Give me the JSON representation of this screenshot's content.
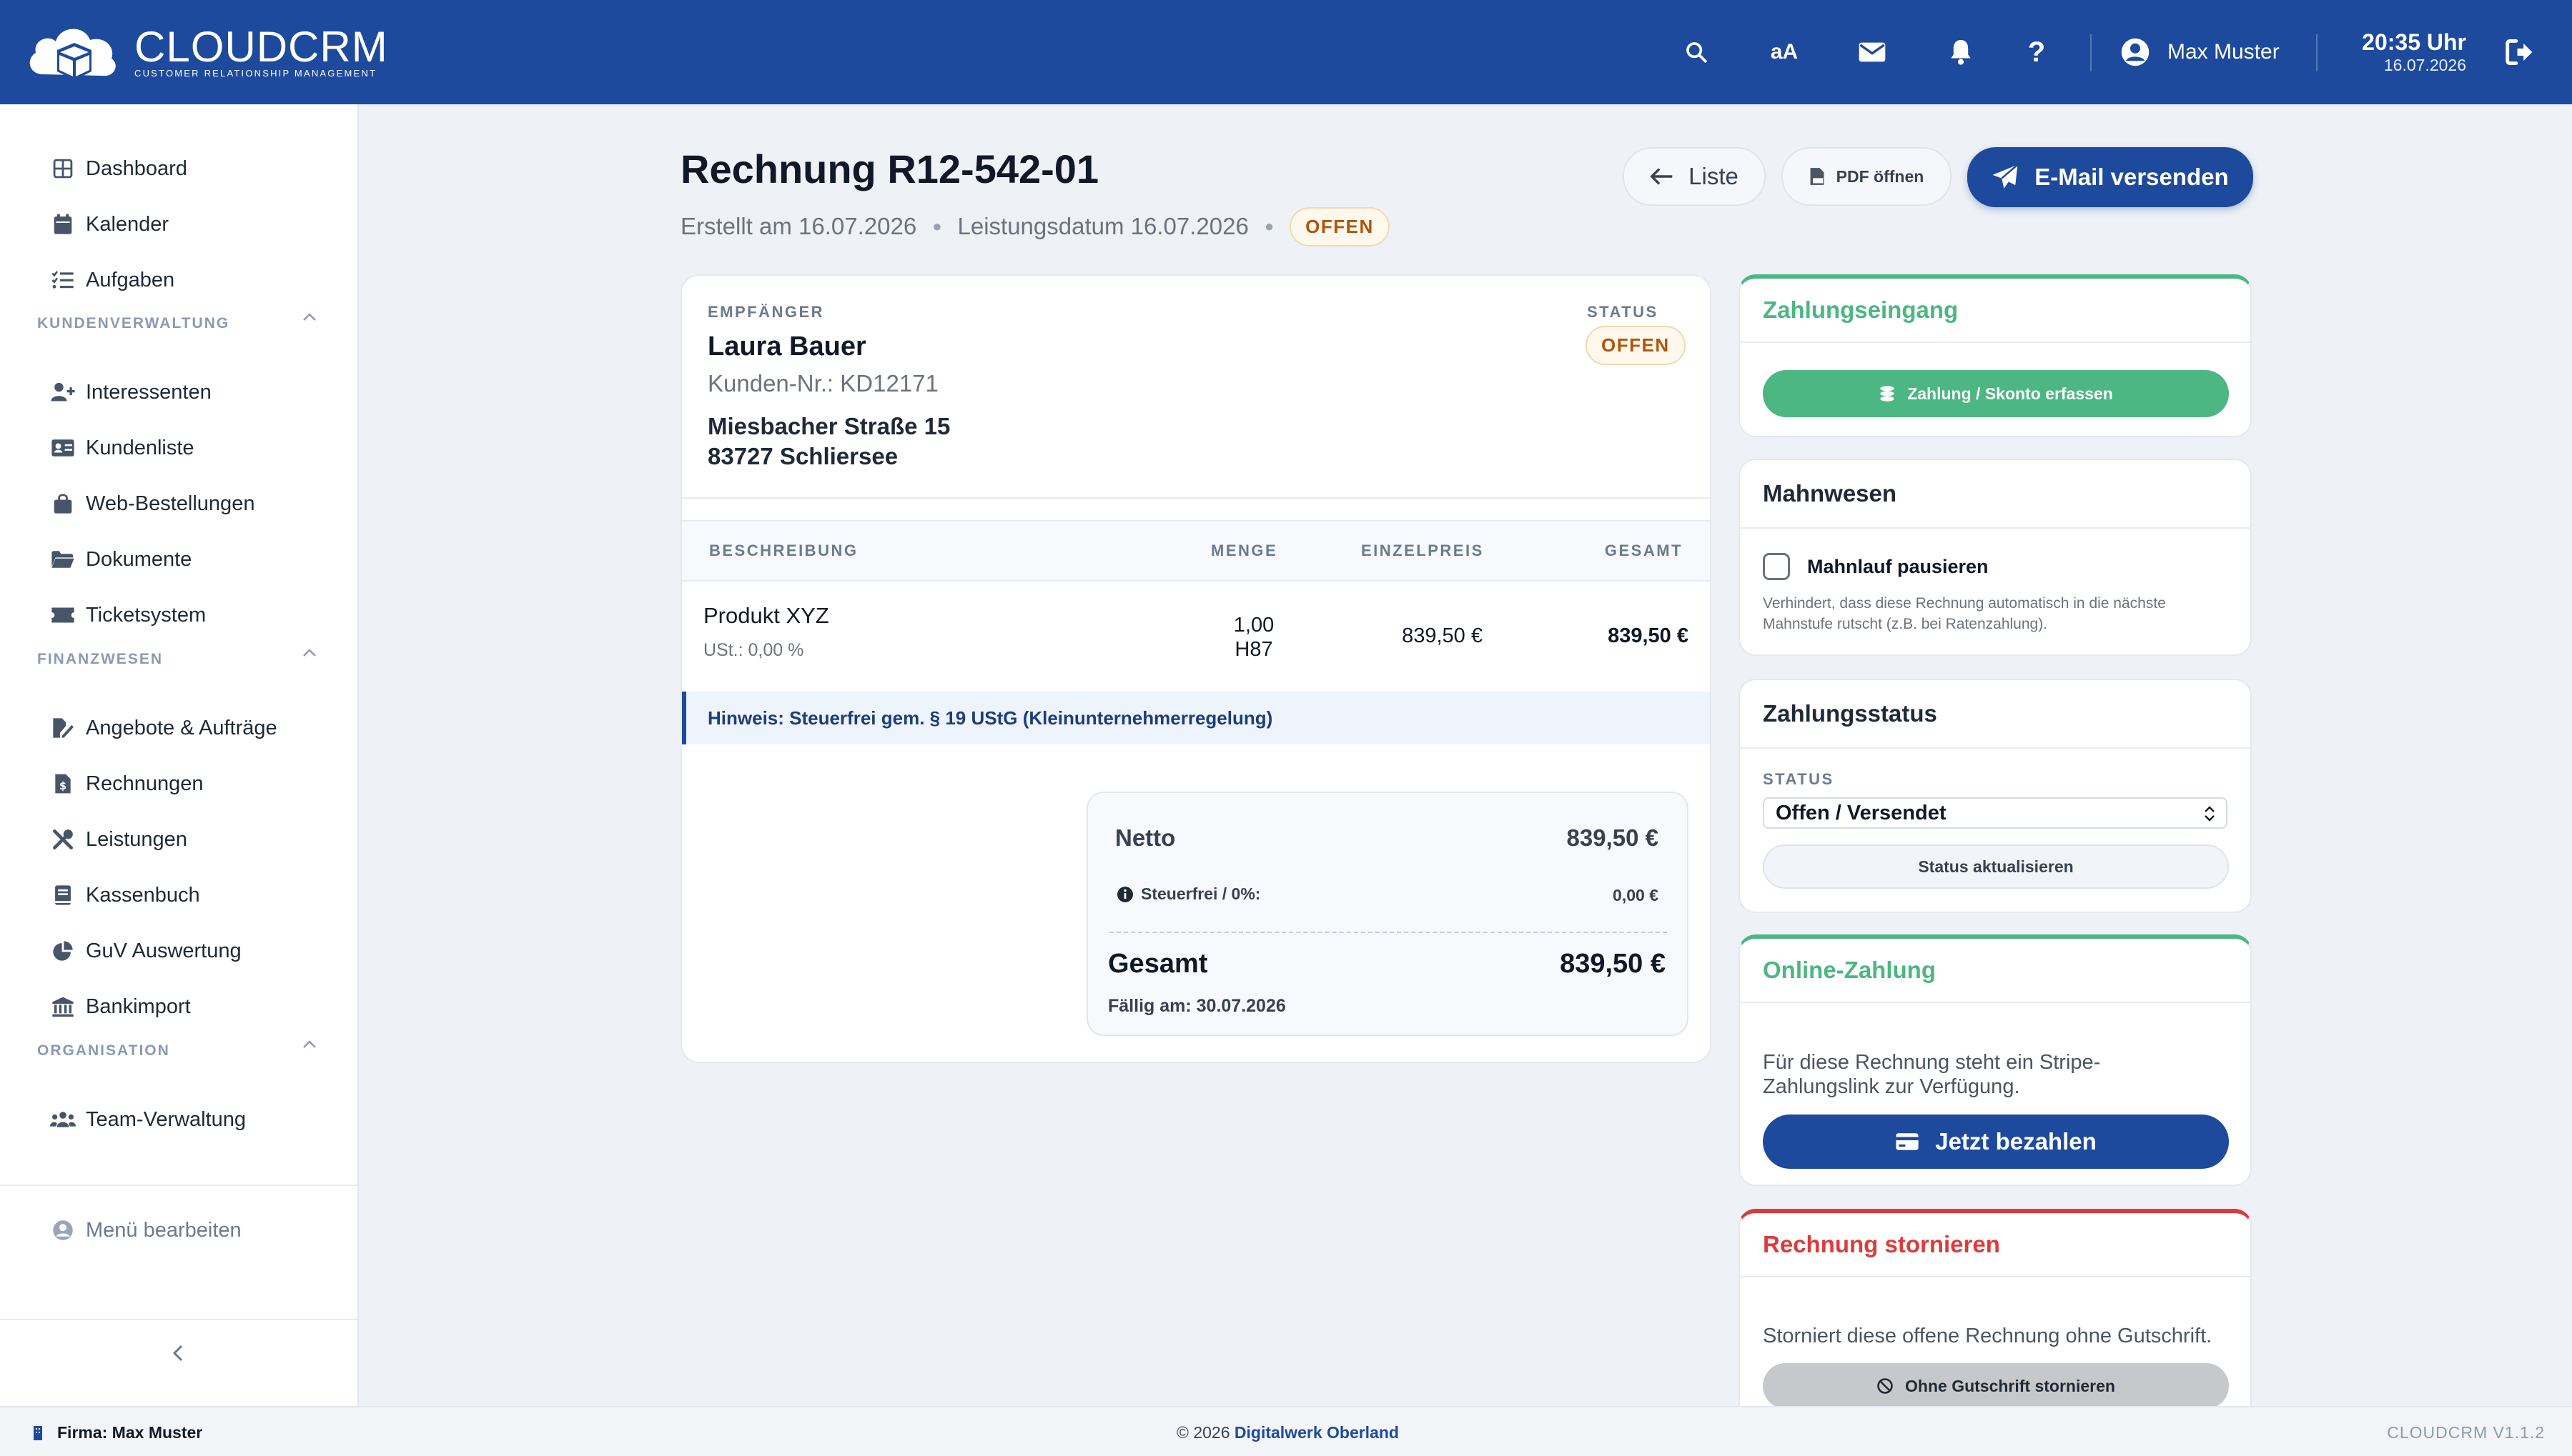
{
  "app": {
    "logo_name": "CLOUDCRM",
    "logo_sub": "CUSTOMER RELATIONSHIP MANAGEMENT",
    "user_name": "Max Muster",
    "time": "20:35 Uhr",
    "date": "16.07.2026",
    "font_size_label": "aA"
  },
  "sidebar": {
    "top_items": [
      {
        "label": "Dashboard",
        "icon": "dashboard-icon"
      },
      {
        "label": "Kalender",
        "icon": "calendar-icon"
      },
      {
        "label": "Aufgaben",
        "icon": "tasks-icon"
      }
    ],
    "sections": [
      {
        "title": "KUNDENVERWALTUNG",
        "items": [
          {
            "label": "Interessenten",
            "icon": "user-plus-icon"
          },
          {
            "label": "Kundenliste",
            "icon": "id-card-icon"
          },
          {
            "label": "Web-Bestellungen",
            "icon": "shopping-bag-icon"
          },
          {
            "label": "Dokumente",
            "icon": "folder-icon"
          },
          {
            "label": "Ticketsystem",
            "icon": "ticket-icon"
          }
        ]
      },
      {
        "title": "FINANZWESEN",
        "items": [
          {
            "label": "Angebote & Aufträge",
            "icon": "file-signature-icon"
          },
          {
            "label": "Rechnungen",
            "icon": "invoice-icon"
          },
          {
            "label": "Leistungen",
            "icon": "tools-icon"
          },
          {
            "label": "Kassenbuch",
            "icon": "book-icon"
          },
          {
            "label": "GuV Auswertung",
            "icon": "pie-chart-icon"
          },
          {
            "label": "Bankimport",
            "icon": "bank-icon"
          }
        ]
      },
      {
        "title": "ORGANISATION",
        "items": [
          {
            "label": "Team-Verwaltung",
            "icon": "users-icon"
          }
        ]
      }
    ],
    "edit_menu": "Menü bearbeiten"
  },
  "invoice": {
    "title": "Rechnung R12-542-01",
    "created": "Erstellt am 16.07.2026",
    "service_date": "Leistungsdatum 16.07.2026",
    "status_badge": "OFFEN",
    "buttons": {
      "list": "Liste",
      "pdf": "PDF öffnen",
      "email": "E-Mail versenden"
    },
    "recipient_label": "EMPFÄNGER",
    "recipient_name": "Laura Bauer",
    "customer_no": "Kunden-Nr.: KD12171",
    "street": "Miesbacher Straße 15",
    "city": "83727 Schliersee",
    "status_label": "STATUS",
    "status_value": "OFFEN",
    "table": {
      "headers": [
        "BESCHREIBUNG",
        "MENGE",
        "EINZELPREIS",
        "GESAMT"
      ],
      "rows": [
        {
          "desc": "Produkt XYZ",
          "tax": "USt.: 0,00 %",
          "qty": "1,00",
          "unit": "H87",
          "price": "839,50 €",
          "total": "839,50 €"
        }
      ]
    },
    "note": "Hinweis: Steuerfrei gem. § 19 UStG (Kleinunternehmerregelung)",
    "totals": {
      "net_label": "Netto",
      "net_value": "839,50 €",
      "tax_label": "Steuerfrei / 0%:",
      "tax_value": "0,00 €",
      "total_label": "Gesamt",
      "total_value": "839,50 €",
      "due": "Fällig am: 30.07.2026"
    }
  },
  "panels": {
    "payment": {
      "title": "Zahlungseingang",
      "button": "Zahlung / Skonto erfassen"
    },
    "dunning": {
      "title": "Mahnwesen",
      "checkbox_label": "Mahnlauf pausieren",
      "checked": false,
      "help": "Verhindert, dass diese Rechnung automatisch in die nächste Mahnstufe rutscht (z.B. bei Ratenzahlung)."
    },
    "status": {
      "title": "Zahlungsstatus",
      "label": "STATUS",
      "selected": "Offen / Versendet",
      "button": "Status aktualisieren"
    },
    "online": {
      "title": "Online-Zahlung",
      "text": "Für diese Rechnung steht ein Stripe-Zahlungslink zur Verfügung.",
      "button": "Jetzt bezahlen"
    },
    "cancel": {
      "title": "Rechnung stornieren",
      "text": "Storniert diese offene Rechnung ohne Gutschrift.",
      "button": "Ohne Gutschrift stornieren"
    }
  },
  "footer": {
    "company": "Firma: Max Muster",
    "copyright": "© 2026",
    "company_link": "Digitalwerk Oberland",
    "version": "CLOUDCRM V1.1.2"
  },
  "colors": {
    "brand": "#1d4a9c",
    "green": "#4cb782",
    "red": "#dc3b3b",
    "badge": "#b45309"
  }
}
